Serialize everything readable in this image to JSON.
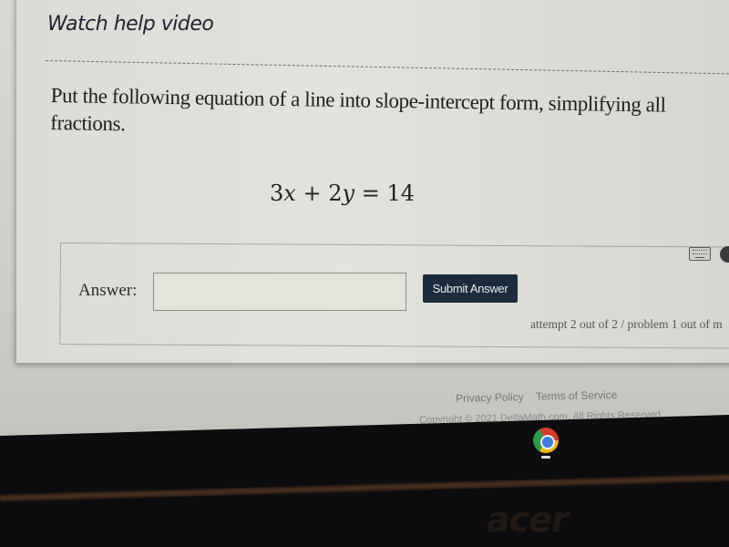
{
  "page": {
    "help_link": "Watch help video",
    "question": "Put the following equation of a line into slope-intercept form, simplifying all fractions.",
    "equation": {
      "term1_coef": "3",
      "term1_var": "x",
      "op": "+",
      "term2_coef": "2",
      "term2_var": "y",
      "eq": "=",
      "rhs": "14"
    }
  },
  "answer": {
    "label": "Answer:",
    "input_value": "",
    "input_placeholder": "",
    "submit_label": "Submit Answer",
    "status": "attempt 2 out of 2 / problem 1 out of m"
  },
  "toolbar": {
    "icons": [
      "keyboard-icon",
      "more-icon"
    ]
  },
  "footer": {
    "privacy": "Privacy Policy",
    "terms": "Terms of Service",
    "copyright": "Copyright © 2021 DeltaMath.com. All Rights Reserved."
  },
  "device": {
    "shelf_app": "chrome-icon",
    "brand": "acer"
  },
  "colors": {
    "submit_bg": "#1a2c3d",
    "page_bg": "#e2e3dc",
    "text": "#1e1e1e"
  }
}
